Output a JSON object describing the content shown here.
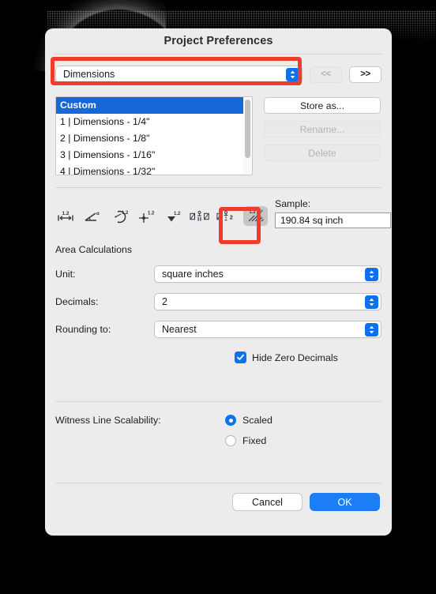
{
  "window": {
    "title": "Project Preferences"
  },
  "top": {
    "popup_value": "Dimensions",
    "prev_label": "<<",
    "next_label": ">>"
  },
  "list": {
    "items": [
      "Custom",
      "1 | Dimensions - 1/4\"",
      "2 | Dimensions - 1/8\"",
      "3 | Dimensions - 1/16\"",
      "4 | Dimensions - 1/32\""
    ],
    "selected_index": 0,
    "buttons": [
      {
        "label": "Store as...",
        "enabled": true
      },
      {
        "label": "Rename...",
        "enabled": false
      },
      {
        "label": "Delete",
        "enabled": false
      }
    ]
  },
  "toolbar": {
    "icons": [
      "linear-dimension-icon",
      "angular-dimension-icon",
      "radial-dimension-icon",
      "datum-dimension-icon",
      "leader-dimension-icon",
      "level-dimension-icon",
      "elevation-dimension-icon",
      "area-dimension-icon"
    ],
    "active_icon": "area-dimension-icon",
    "active_icon_label": "1.2 m²"
  },
  "sample": {
    "label": "Sample:",
    "value": "190.84 sq inch"
  },
  "area_calculations": {
    "title": "Area Calculations",
    "unit": {
      "label": "Unit:",
      "value": "square inches"
    },
    "decimals": {
      "label": "Decimals:",
      "value": "2"
    },
    "rounding": {
      "label": "Rounding to:",
      "value": "Nearest"
    },
    "hide_zero_decimals": {
      "label": "Hide Zero Decimals",
      "checked": true
    }
  },
  "witness": {
    "label": "Witness Line Scalability:",
    "options": [
      {
        "label": "Scaled",
        "selected": true
      },
      {
        "label": "Fixed",
        "selected": false
      }
    ]
  },
  "footer": {
    "cancel_label": "Cancel",
    "ok_label": "OK"
  },
  "colors": {
    "accent": "#0a71f2",
    "selection": "#1667d8",
    "primary_button": "#1b7ef4",
    "highlight": "#f03c2e",
    "panel": "#ececec"
  }
}
